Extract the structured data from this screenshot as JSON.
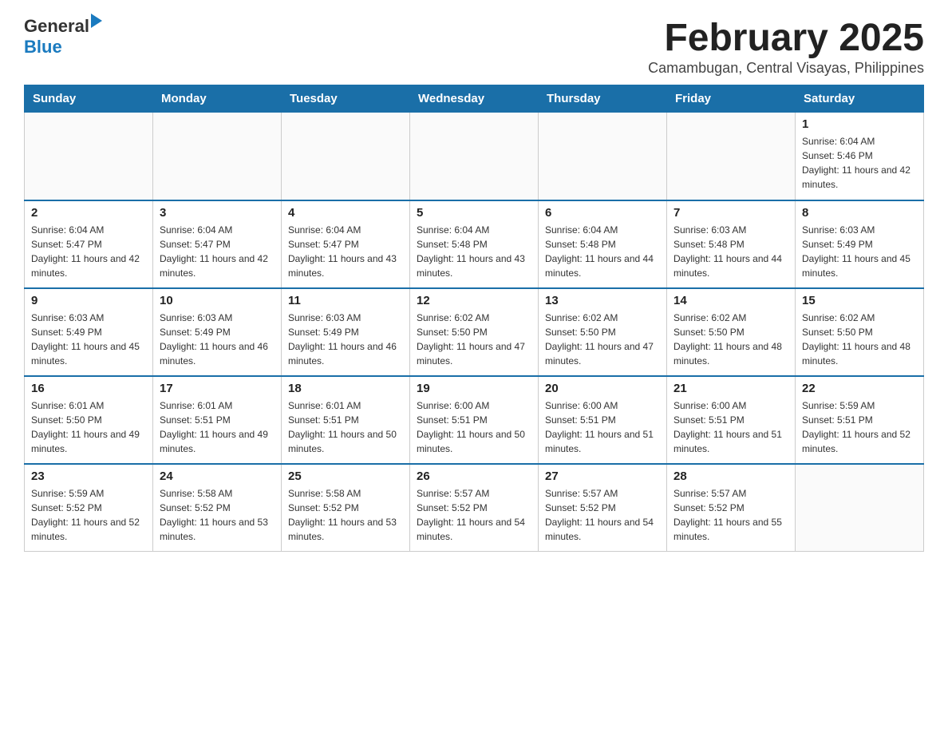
{
  "header": {
    "logo_general": "General",
    "logo_blue": "Blue",
    "month_title": "February 2025",
    "location": "Camambugan, Central Visayas, Philippines"
  },
  "weekdays": [
    "Sunday",
    "Monday",
    "Tuesday",
    "Wednesday",
    "Thursday",
    "Friday",
    "Saturday"
  ],
  "weeks": [
    [
      {
        "day": "",
        "sunrise": "",
        "sunset": "",
        "daylight": ""
      },
      {
        "day": "",
        "sunrise": "",
        "sunset": "",
        "daylight": ""
      },
      {
        "day": "",
        "sunrise": "",
        "sunset": "",
        "daylight": ""
      },
      {
        "day": "",
        "sunrise": "",
        "sunset": "",
        "daylight": ""
      },
      {
        "day": "",
        "sunrise": "",
        "sunset": "",
        "daylight": ""
      },
      {
        "day": "",
        "sunrise": "",
        "sunset": "",
        "daylight": ""
      },
      {
        "day": "1",
        "sunrise": "Sunrise: 6:04 AM",
        "sunset": "Sunset: 5:46 PM",
        "daylight": "Daylight: 11 hours and 42 minutes."
      }
    ],
    [
      {
        "day": "2",
        "sunrise": "Sunrise: 6:04 AM",
        "sunset": "Sunset: 5:47 PM",
        "daylight": "Daylight: 11 hours and 42 minutes."
      },
      {
        "day": "3",
        "sunrise": "Sunrise: 6:04 AM",
        "sunset": "Sunset: 5:47 PM",
        "daylight": "Daylight: 11 hours and 42 minutes."
      },
      {
        "day": "4",
        "sunrise": "Sunrise: 6:04 AM",
        "sunset": "Sunset: 5:47 PM",
        "daylight": "Daylight: 11 hours and 43 minutes."
      },
      {
        "day": "5",
        "sunrise": "Sunrise: 6:04 AM",
        "sunset": "Sunset: 5:48 PM",
        "daylight": "Daylight: 11 hours and 43 minutes."
      },
      {
        "day": "6",
        "sunrise": "Sunrise: 6:04 AM",
        "sunset": "Sunset: 5:48 PM",
        "daylight": "Daylight: 11 hours and 44 minutes."
      },
      {
        "day": "7",
        "sunrise": "Sunrise: 6:03 AM",
        "sunset": "Sunset: 5:48 PM",
        "daylight": "Daylight: 11 hours and 44 minutes."
      },
      {
        "day": "8",
        "sunrise": "Sunrise: 6:03 AM",
        "sunset": "Sunset: 5:49 PM",
        "daylight": "Daylight: 11 hours and 45 minutes."
      }
    ],
    [
      {
        "day": "9",
        "sunrise": "Sunrise: 6:03 AM",
        "sunset": "Sunset: 5:49 PM",
        "daylight": "Daylight: 11 hours and 45 minutes."
      },
      {
        "day": "10",
        "sunrise": "Sunrise: 6:03 AM",
        "sunset": "Sunset: 5:49 PM",
        "daylight": "Daylight: 11 hours and 46 minutes."
      },
      {
        "day": "11",
        "sunrise": "Sunrise: 6:03 AM",
        "sunset": "Sunset: 5:49 PM",
        "daylight": "Daylight: 11 hours and 46 minutes."
      },
      {
        "day": "12",
        "sunrise": "Sunrise: 6:02 AM",
        "sunset": "Sunset: 5:50 PM",
        "daylight": "Daylight: 11 hours and 47 minutes."
      },
      {
        "day": "13",
        "sunrise": "Sunrise: 6:02 AM",
        "sunset": "Sunset: 5:50 PM",
        "daylight": "Daylight: 11 hours and 47 minutes."
      },
      {
        "day": "14",
        "sunrise": "Sunrise: 6:02 AM",
        "sunset": "Sunset: 5:50 PM",
        "daylight": "Daylight: 11 hours and 48 minutes."
      },
      {
        "day": "15",
        "sunrise": "Sunrise: 6:02 AM",
        "sunset": "Sunset: 5:50 PM",
        "daylight": "Daylight: 11 hours and 48 minutes."
      }
    ],
    [
      {
        "day": "16",
        "sunrise": "Sunrise: 6:01 AM",
        "sunset": "Sunset: 5:50 PM",
        "daylight": "Daylight: 11 hours and 49 minutes."
      },
      {
        "day": "17",
        "sunrise": "Sunrise: 6:01 AM",
        "sunset": "Sunset: 5:51 PM",
        "daylight": "Daylight: 11 hours and 49 minutes."
      },
      {
        "day": "18",
        "sunrise": "Sunrise: 6:01 AM",
        "sunset": "Sunset: 5:51 PM",
        "daylight": "Daylight: 11 hours and 50 minutes."
      },
      {
        "day": "19",
        "sunrise": "Sunrise: 6:00 AM",
        "sunset": "Sunset: 5:51 PM",
        "daylight": "Daylight: 11 hours and 50 minutes."
      },
      {
        "day": "20",
        "sunrise": "Sunrise: 6:00 AM",
        "sunset": "Sunset: 5:51 PM",
        "daylight": "Daylight: 11 hours and 51 minutes."
      },
      {
        "day": "21",
        "sunrise": "Sunrise: 6:00 AM",
        "sunset": "Sunset: 5:51 PM",
        "daylight": "Daylight: 11 hours and 51 minutes."
      },
      {
        "day": "22",
        "sunrise": "Sunrise: 5:59 AM",
        "sunset": "Sunset: 5:51 PM",
        "daylight": "Daylight: 11 hours and 52 minutes."
      }
    ],
    [
      {
        "day": "23",
        "sunrise": "Sunrise: 5:59 AM",
        "sunset": "Sunset: 5:52 PM",
        "daylight": "Daylight: 11 hours and 52 minutes."
      },
      {
        "day": "24",
        "sunrise": "Sunrise: 5:58 AM",
        "sunset": "Sunset: 5:52 PM",
        "daylight": "Daylight: 11 hours and 53 minutes."
      },
      {
        "day": "25",
        "sunrise": "Sunrise: 5:58 AM",
        "sunset": "Sunset: 5:52 PM",
        "daylight": "Daylight: 11 hours and 53 minutes."
      },
      {
        "day": "26",
        "sunrise": "Sunrise: 5:57 AM",
        "sunset": "Sunset: 5:52 PM",
        "daylight": "Daylight: 11 hours and 54 minutes."
      },
      {
        "day": "27",
        "sunrise": "Sunrise: 5:57 AM",
        "sunset": "Sunset: 5:52 PM",
        "daylight": "Daylight: 11 hours and 54 minutes."
      },
      {
        "day": "28",
        "sunrise": "Sunrise: 5:57 AM",
        "sunset": "Sunset: 5:52 PM",
        "daylight": "Daylight: 11 hours and 55 minutes."
      },
      {
        "day": "",
        "sunrise": "",
        "sunset": "",
        "daylight": ""
      }
    ]
  ]
}
